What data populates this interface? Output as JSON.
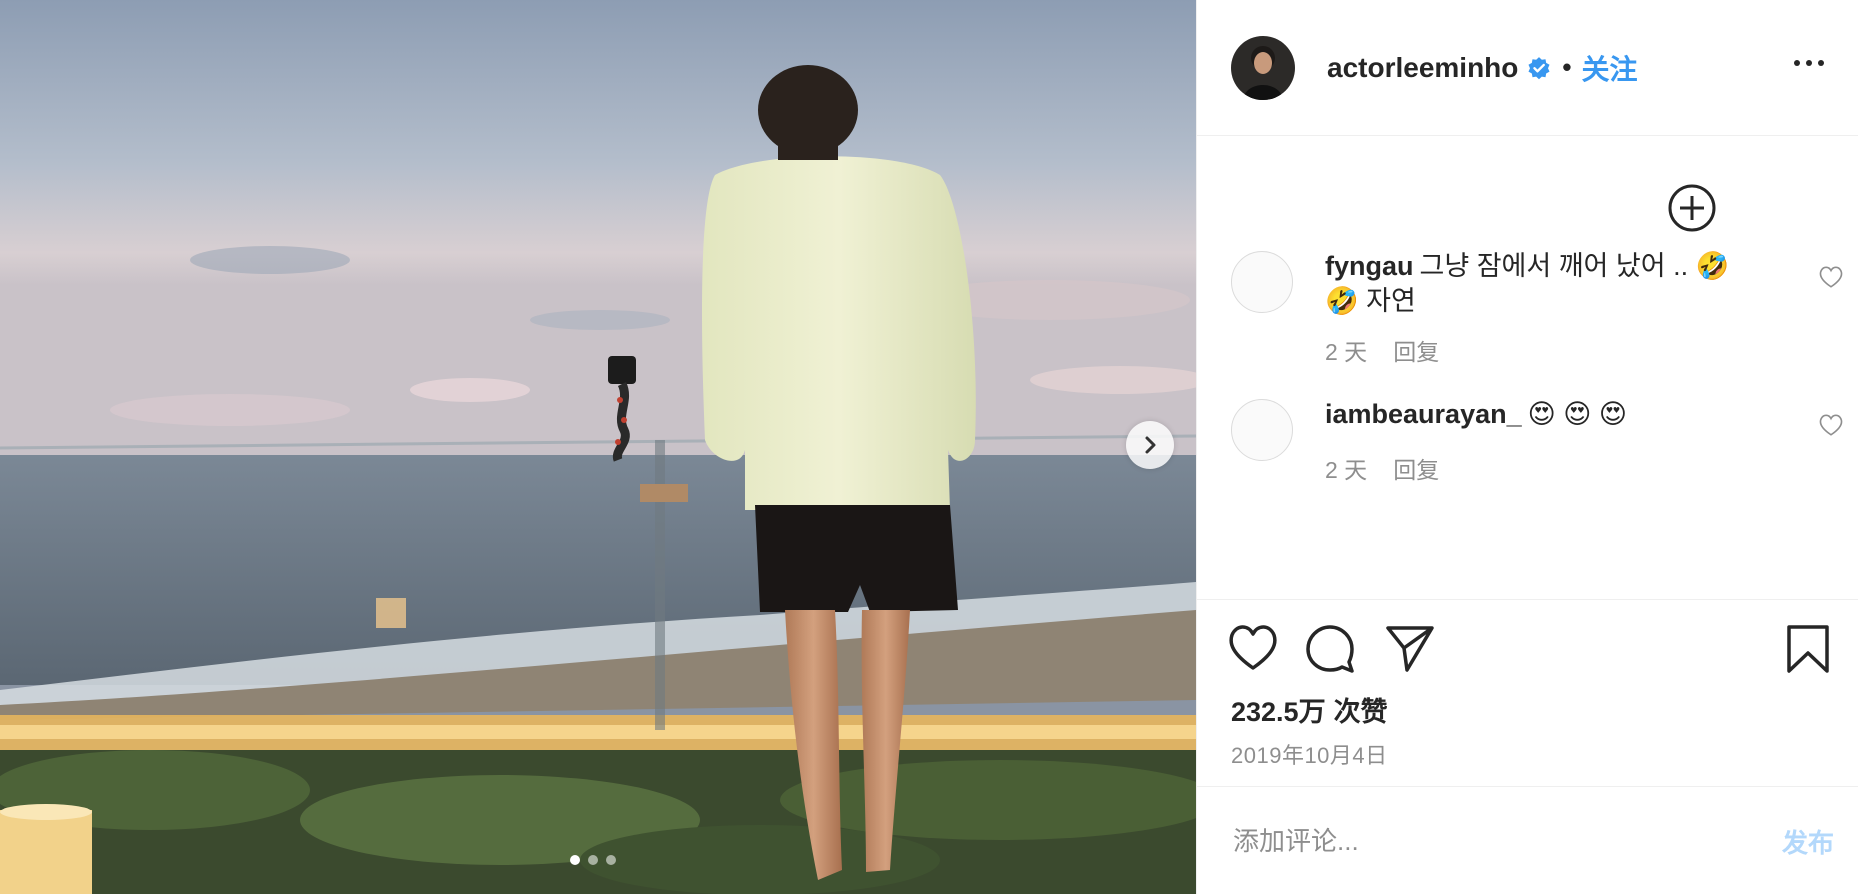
{
  "header": {
    "username": "actorleeminho",
    "separator": "•",
    "follow_label": "关注",
    "more_icon": "more-horizontal-icon"
  },
  "comments": [
    {
      "username": "fyngau",
      "text": "그냥 잠에서 깨어 났어 .. 🤣🤣  자연",
      "time": "2 天",
      "reply_label": "回复"
    },
    {
      "username": "iambeaurayan_",
      "text": "😍 😍 😍",
      "time": "2 天",
      "reply_label": "回复"
    }
  ],
  "actions": {
    "likes_count": "232.5万",
    "likes_unit": "次赞",
    "date": "2019年10月4日"
  },
  "composer": {
    "placeholder": "添加评论...",
    "post_label": "发布"
  },
  "carousel": {
    "total": 3,
    "active": 1
  },
  "colors": {
    "accent": "#3897f0",
    "post_disabled": "#b3d8fb",
    "muted": "#8e8e8e",
    "text": "#262626"
  }
}
